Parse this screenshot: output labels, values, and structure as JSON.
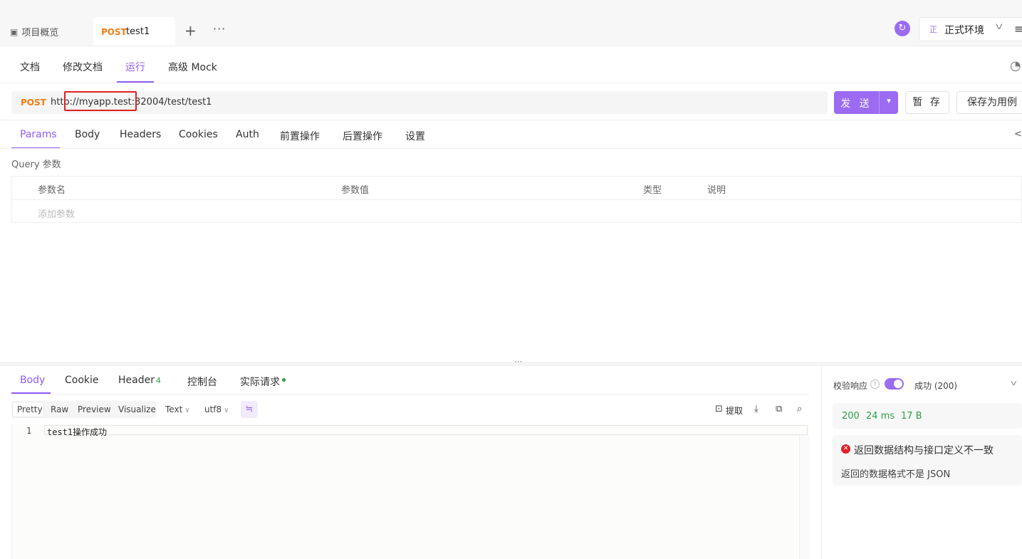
{
  "tabs": {
    "overview_label": "项目概览",
    "active_method": "POST",
    "active_name": "test1"
  },
  "env": {
    "badge": "正",
    "label": "正式环境"
  },
  "sub_tabs": [
    "文档",
    "修改文档",
    "运行",
    "高级 Mock"
  ],
  "request": {
    "method": "POST",
    "url": "http://myapp.test:32004/test/test1",
    "send_label": "发 送",
    "save_temp_label": "暂 存",
    "save_case_label": "保存为用例"
  },
  "param_tabs": [
    "Params",
    "Body",
    "Headers",
    "Cookies",
    "Auth",
    "前置操作",
    "后置操作",
    "设置"
  ],
  "params": {
    "section_label": "Query 参数",
    "columns": [
      "参数名",
      "参数值",
      "类型",
      "说明"
    ],
    "add_placeholder": "添加参数"
  },
  "response": {
    "tabs": [
      "Body",
      "Cookie",
      "Header",
      "控制台",
      "实际请求"
    ],
    "header_count": "4",
    "view_modes": [
      "Pretty",
      "Raw",
      "Preview",
      "Visualize"
    ],
    "format": "Text",
    "encoding": "utf8",
    "extract_label": "提取",
    "lines": [
      {
        "no": "1",
        "text": "test1操作成功"
      }
    ]
  },
  "validation": {
    "label": "校验响应",
    "result": "成功 (200)",
    "status": "200",
    "time": "24 ms",
    "size": "17 B",
    "error_title": "返回数据结构与接口定义不一致",
    "error_detail": "返回的数据格式不是 JSON"
  },
  "colors": {
    "accent": "#9b6bf2",
    "method": "#f27b13",
    "success": "#2ba245",
    "error": "#e0202a",
    "highlight": "#e02020"
  }
}
